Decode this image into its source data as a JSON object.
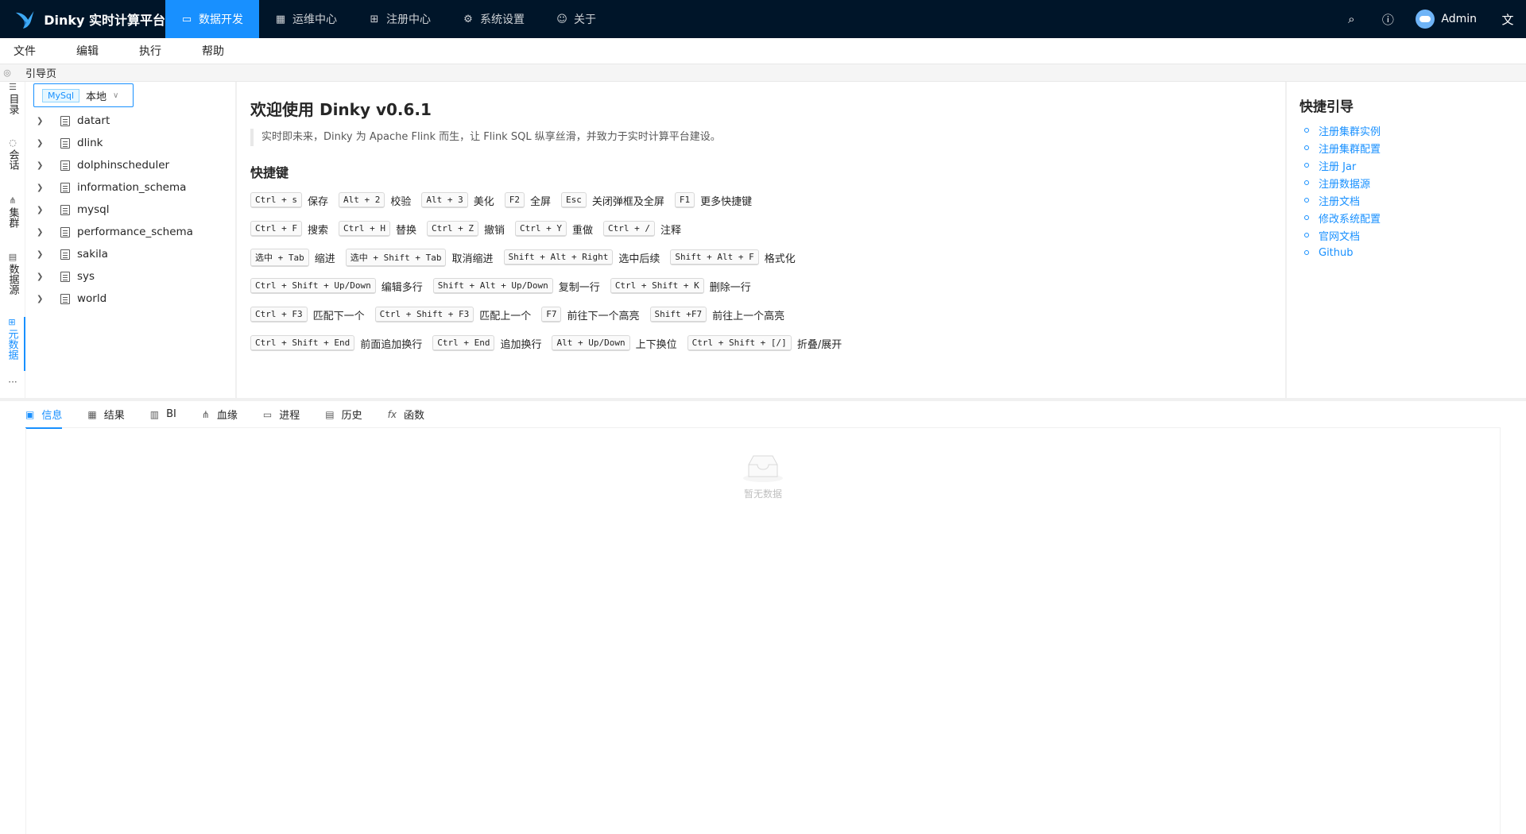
{
  "app": {
    "title": "Dinky 实时计算平台",
    "accent": "#1890ff",
    "header_bg": "#001529"
  },
  "nav": [
    {
      "label": "数据开发",
      "icon": "monitor-icon",
      "active": true
    },
    {
      "label": "运维中心",
      "icon": "dashboard-icon",
      "active": false
    },
    {
      "label": "注册中心",
      "icon": "appstore-icon",
      "active": false
    },
    {
      "label": "系统设置",
      "icon": "gear-icon",
      "active": false
    },
    {
      "label": "关于",
      "icon": "smile-icon",
      "active": false
    }
  ],
  "header_right": {
    "user": "Admin"
  },
  "menu": [
    "文件",
    "编辑",
    "执行",
    "帮助"
  ],
  "tab": {
    "label": "引导页"
  },
  "vside": [
    {
      "label": "目录",
      "icon": "list-icon"
    },
    {
      "label": "会话",
      "icon": "message-icon"
    },
    {
      "label": "集群",
      "icon": "cluster-icon"
    },
    {
      "label": "数据源",
      "icon": "database-icon"
    },
    {
      "label": "元数据",
      "icon": "appstore-icon",
      "active": true
    }
  ],
  "db": {
    "type_tag": "MySql",
    "name": "本地",
    "schemas": [
      "datart",
      "dlink",
      "dolphinscheduler",
      "information_schema",
      "mysql",
      "performance_schema",
      "sakila",
      "sys",
      "world"
    ]
  },
  "welcome": {
    "title": "欢迎使用 Dinky v0.6.1",
    "quote": "实时即未来，Dinky 为 Apache Flink 而生，让 Flink SQL 纵享丝滑，并致力于实时计算平台建设。",
    "shortcut_title": "快捷键",
    "shortcuts": [
      [
        {
          "key": "Ctrl + s",
          "desc": "保存"
        },
        {
          "key": "Alt + 2",
          "desc": "校验"
        },
        {
          "key": "Alt + 3",
          "desc": "美化"
        },
        {
          "key": "F2",
          "desc": "全屏"
        },
        {
          "key": "Esc",
          "desc": "关闭弹框及全屏"
        },
        {
          "key": "F1",
          "desc": "更多快捷键"
        }
      ],
      [
        {
          "key": "Ctrl + F",
          "desc": "搜索"
        },
        {
          "key": "Ctrl + H",
          "desc": "替换"
        },
        {
          "key": "Ctrl + Z",
          "desc": "撤销"
        },
        {
          "key": "Ctrl + Y",
          "desc": "重做"
        },
        {
          "key": "Ctrl + /",
          "desc": "注释"
        }
      ],
      [
        {
          "key": "选中 + Tab",
          "desc": "缩进"
        },
        {
          "key": "选中 + Shift + Tab",
          "desc": "取消缩进"
        },
        {
          "key": "Shift + Alt + Right",
          "desc": "选中后续"
        },
        {
          "key": "Shift + Alt + F",
          "desc": "格式化"
        }
      ],
      [
        {
          "key": "Ctrl + Shift + Up/Down",
          "desc": "编辑多行"
        },
        {
          "key": "Shift + Alt + Up/Down",
          "desc": "复制一行"
        },
        {
          "key": "Ctrl + Shift + K",
          "desc": "删除一行"
        }
      ],
      [
        {
          "key": "Ctrl + F3",
          "desc": "匹配下一个"
        },
        {
          "key": "Ctrl + Shift + F3",
          "desc": "匹配上一个"
        },
        {
          "key": "F7",
          "desc": "前往下一个高亮"
        },
        {
          "key": "Shift +F7",
          "desc": "前往上一个高亮"
        }
      ],
      [
        {
          "key": "Ctrl + Shift + End",
          "desc": "前面追加换行"
        },
        {
          "key": "Ctrl + End",
          "desc": "追加换行"
        },
        {
          "key": "Alt + Up/Down",
          "desc": "上下换位"
        },
        {
          "key": "Ctrl + Shift + [/]",
          "desc": "折叠/展开"
        }
      ]
    ]
  },
  "guide": {
    "title": "快捷引导",
    "links": [
      "注册集群实例",
      "注册集群配置",
      "注册 Jar",
      "注册数据源",
      "注册文档",
      "修改系统配置",
      "官网文档",
      "Github"
    ]
  },
  "bottom_tabs": [
    {
      "label": "信息",
      "icon": "code-icon",
      "active": true
    },
    {
      "label": "结果",
      "icon": "table-icon"
    },
    {
      "label": "BI",
      "icon": "bar-chart-icon"
    },
    {
      "label": "血缘",
      "icon": "apartment-icon"
    },
    {
      "label": "进程",
      "icon": "desktop-icon"
    },
    {
      "label": "历史",
      "icon": "calendar-icon"
    },
    {
      "label": "函数",
      "icon": "function-icon"
    }
  ],
  "empty_text": "暂无数据"
}
